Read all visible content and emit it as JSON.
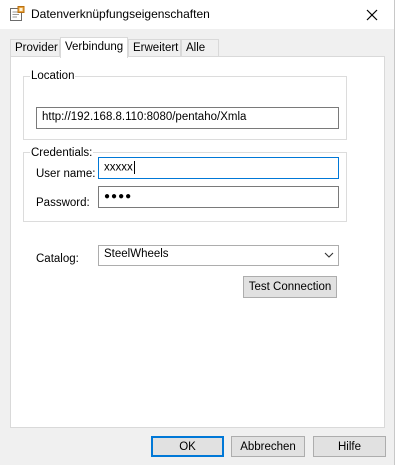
{
  "window": {
    "title": "Datenverknüpfungseigenschaften",
    "icon": "data-link-properties-icon",
    "close_icon": "close-icon"
  },
  "tabs": [
    {
      "label": "Provider",
      "active": false
    },
    {
      "label": "Verbindung",
      "active": true
    },
    {
      "label": "Erweitert",
      "active": false
    },
    {
      "label": "Alle",
      "active": false
    }
  ],
  "location": {
    "group_label": "Location",
    "value": "http://192.168.8.110:8080/pentaho/Xmla"
  },
  "credentials": {
    "group_label": "Credentials:",
    "username_label": "User name:",
    "username_value": "xxxxx",
    "password_label": "Password:",
    "password_value": "●●●●"
  },
  "catalog": {
    "label": "Catalog:",
    "selected": "SteelWheels"
  },
  "buttons": {
    "test_connection": "Test Connection",
    "ok": "OK",
    "cancel": "Abbrechen",
    "help": "Hilfe"
  },
  "colors": {
    "accent": "#0078d7",
    "panel": "#ffffff",
    "dialog_bg": "#f0f0f0"
  }
}
